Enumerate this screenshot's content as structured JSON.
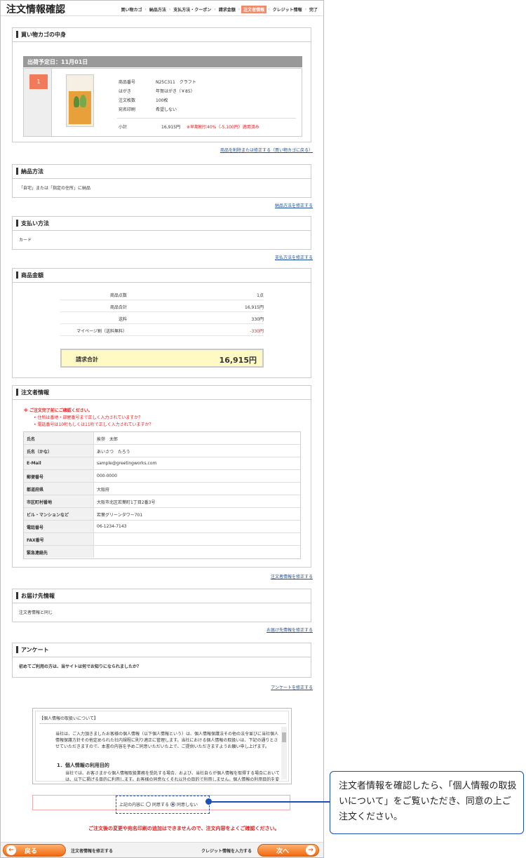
{
  "page_title": "注文情報確認",
  "steps": [
    "買い物カゴ",
    "納品方法",
    "支払方法・クーポン",
    "請求金額",
    "注文者情報",
    "クレジット情報",
    "完了"
  ],
  "active_step_index": 4,
  "cart": {
    "title": "買い物カゴの中身",
    "ship_date": "出荷予定日：11月01日",
    "item_no": "1",
    "rows": [
      {
        "k": "商品番号",
        "v": "N25C311　クラフト"
      },
      {
        "k": "はがき",
        "v": "年賀はがき（￥85）"
      },
      {
        "k": "注文枚数",
        "v": "100枚"
      },
      {
        "k": "宛名印刷",
        "v": "希望しない"
      }
    ],
    "subtotal_label": "小計",
    "subtotal_value": "16,915円",
    "discount_note": "※早期割引40%（-5,100円）適用済み",
    "edit_link": "商品を削除または修正する（買い物カゴに戻る）"
  },
  "delivery": {
    "title": "納品方法",
    "body": "「自宅」または「指定の住所」に納品",
    "edit_link": "納品方法を修正する"
  },
  "payment": {
    "title": "支払い方法",
    "body": "カード",
    "edit_link": "支払方法を修正する"
  },
  "amount": {
    "title": "商品金額",
    "rows": [
      {
        "k": "商品点数",
        "v": "1点"
      },
      {
        "k": "商品合計",
        "v": "16,915円"
      },
      {
        "k": "送料",
        "v": "330円"
      },
      {
        "k": "マイページ割（送料無料）",
        "v": "-330円"
      }
    ],
    "total_label": "請求合計",
    "total_value": "16,915円"
  },
  "orderer": {
    "title": "注文者情報",
    "notice_title": "※ ご注文完了前にご確認ください。",
    "notice_1": "住所は番地・部屋番号まで正しく入力されていますか？",
    "notice_2": "電話番号は10桁もしくは11桁で正しく入力されていますか？",
    "rows": [
      {
        "k": "氏名",
        "v": "挨拶　太郎"
      },
      {
        "k": "氏名（かな）",
        "v": "あいさつ　たろう"
      },
      {
        "k": "E-Mail",
        "v": "sample@greetingworks.com"
      },
      {
        "k": "郵便番号",
        "v": "000-0000"
      },
      {
        "k": "都道府県",
        "v": "大阪府"
      },
      {
        "k": "市区町村番地",
        "v": "大阪市北区若葉町1丁目2番3号"
      },
      {
        "k": "ビル・マンションなど",
        "v": "若葉グリーンタワー701"
      },
      {
        "k": "電話番号",
        "v": "06-1234-7143"
      },
      {
        "k": "FAX番号",
        "v": ""
      },
      {
        "k": "緊急連絡先",
        "v": ""
      }
    ],
    "edit_link": "注文者情報を修正する"
  },
  "shipping": {
    "title": "お届け先情報",
    "body": "注文者情報と同じ",
    "edit_link": "お届け先情報を修正する"
  },
  "survey": {
    "title": "アンケート",
    "body": "初めてご利用の方は、当サイトは何でお知りになられましたか？",
    "edit_link": "アンケートを修正する"
  },
  "privacy": {
    "title": "【個人情報の取扱いについて】",
    "text": "当社は、ご入力頂きましたお客様の個人情報（以下個人情報という）は、個人情報保護法その他の法令並びに当社個人情報保護方針その他定められた社内規程に則り適正に管理します。当社における個人情報の取扱いは、下記の通りとさせていただきますので、本書の内容を予めご同意いただいた上で、ご提供いただきますようお願い申し上げます。",
    "heading": "1．個人情報の利用目的",
    "text2": "当社では、お客さまから個人情報取扱業務を受託する場合、および、当社自らが個人情報を取得する場合においては、以下に掲げる目的に利用します。お客様の同意なくそれ以外の目的で利用しません。個人情報の利用目的を変更する場合には、ご本人の意思を確認します。"
  },
  "agree": {
    "prefix": "上記の内容に",
    "yes": "同意する",
    "no": "同意しない",
    "selected": "no"
  },
  "warning": "ご注文後の変更や宛名印刷の追加はできませんので、注文内容をよくご確認ください。",
  "footer": {
    "back": "戻る",
    "edit_orderer": "注文者情報を修正する",
    "enter_credit": "クレジット情報を入力する",
    "next": "次へ"
  },
  "callout": "注文者情報を確認したら、「個人情報の取扱いについて」をご覧いただき、同意の上ご注文ください。"
}
